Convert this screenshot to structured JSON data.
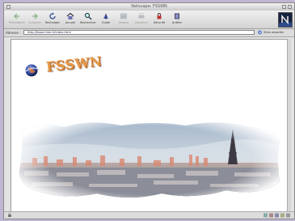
{
  "window": {
    "title": "Netscape: FSSWN"
  },
  "toolbar": {
    "buttons": [
      {
        "label": "Précédente",
        "icon": "back-arrow-icon",
        "disabled": true
      },
      {
        "label": "Suivante",
        "icon": "forward-arrow-icon",
        "disabled": true
      },
      {
        "label": "Recharger",
        "icon": "reload-icon",
        "disabled": false
      },
      {
        "label": "Accueil",
        "icon": "home-icon",
        "disabled": false
      },
      {
        "label": "Rechercher",
        "icon": "search-icon",
        "disabled": false
      },
      {
        "label": "Guide",
        "icon": "guide-icon",
        "disabled": false
      },
      {
        "label": "Images",
        "icon": "images-icon",
        "disabled": true
      },
      {
        "label": "Imprimer",
        "icon": "print-icon",
        "disabled": true
      },
      {
        "label": "Sécurité",
        "icon": "security-icon",
        "disabled": false
      },
      {
        "label": "Arrêter",
        "icon": "stop-icon",
        "disabled": false
      }
    ]
  },
  "address": {
    "label": "Adresse :",
    "url": "http://fsswn.free.fr/index.html",
    "aux": "Sites associés"
  },
  "page": {
    "logo_text": "FSSWN"
  },
  "colors": {
    "desktop": "#bfb6d3",
    "logo": "#e49a49"
  }
}
